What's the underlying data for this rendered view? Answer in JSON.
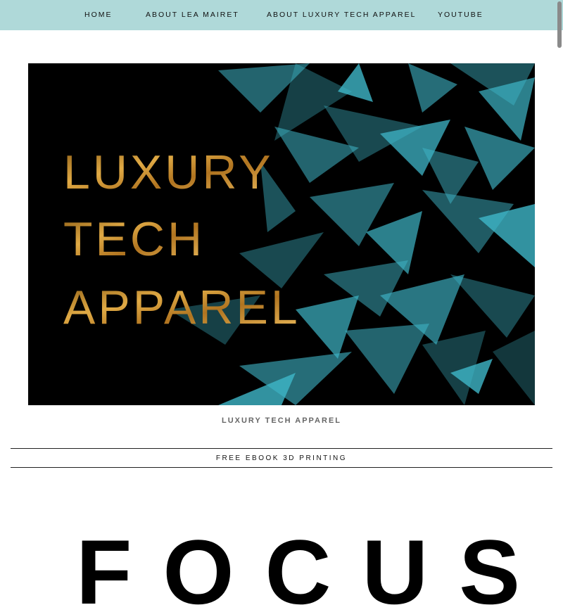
{
  "nav": {
    "items": [
      {
        "label": "HOME"
      },
      {
        "label": "ABOUT LEA MAIRET"
      },
      {
        "label": "ABOUT LUXURY TECH APPAREL"
      },
      {
        "label": "YOUTUBE"
      }
    ],
    "background": "#afd9d9"
  },
  "hero": {
    "lines": [
      "LUXURY",
      "TECH",
      "APPAREL"
    ],
    "text_color": "#c9962e",
    "shard_color": "#3fb6c8"
  },
  "caption": "LUXURY TECH APPAREL",
  "ebook": {
    "label": "FREE EBOOK 3D PRINTING"
  },
  "focus": {
    "text": "FOCUS"
  }
}
